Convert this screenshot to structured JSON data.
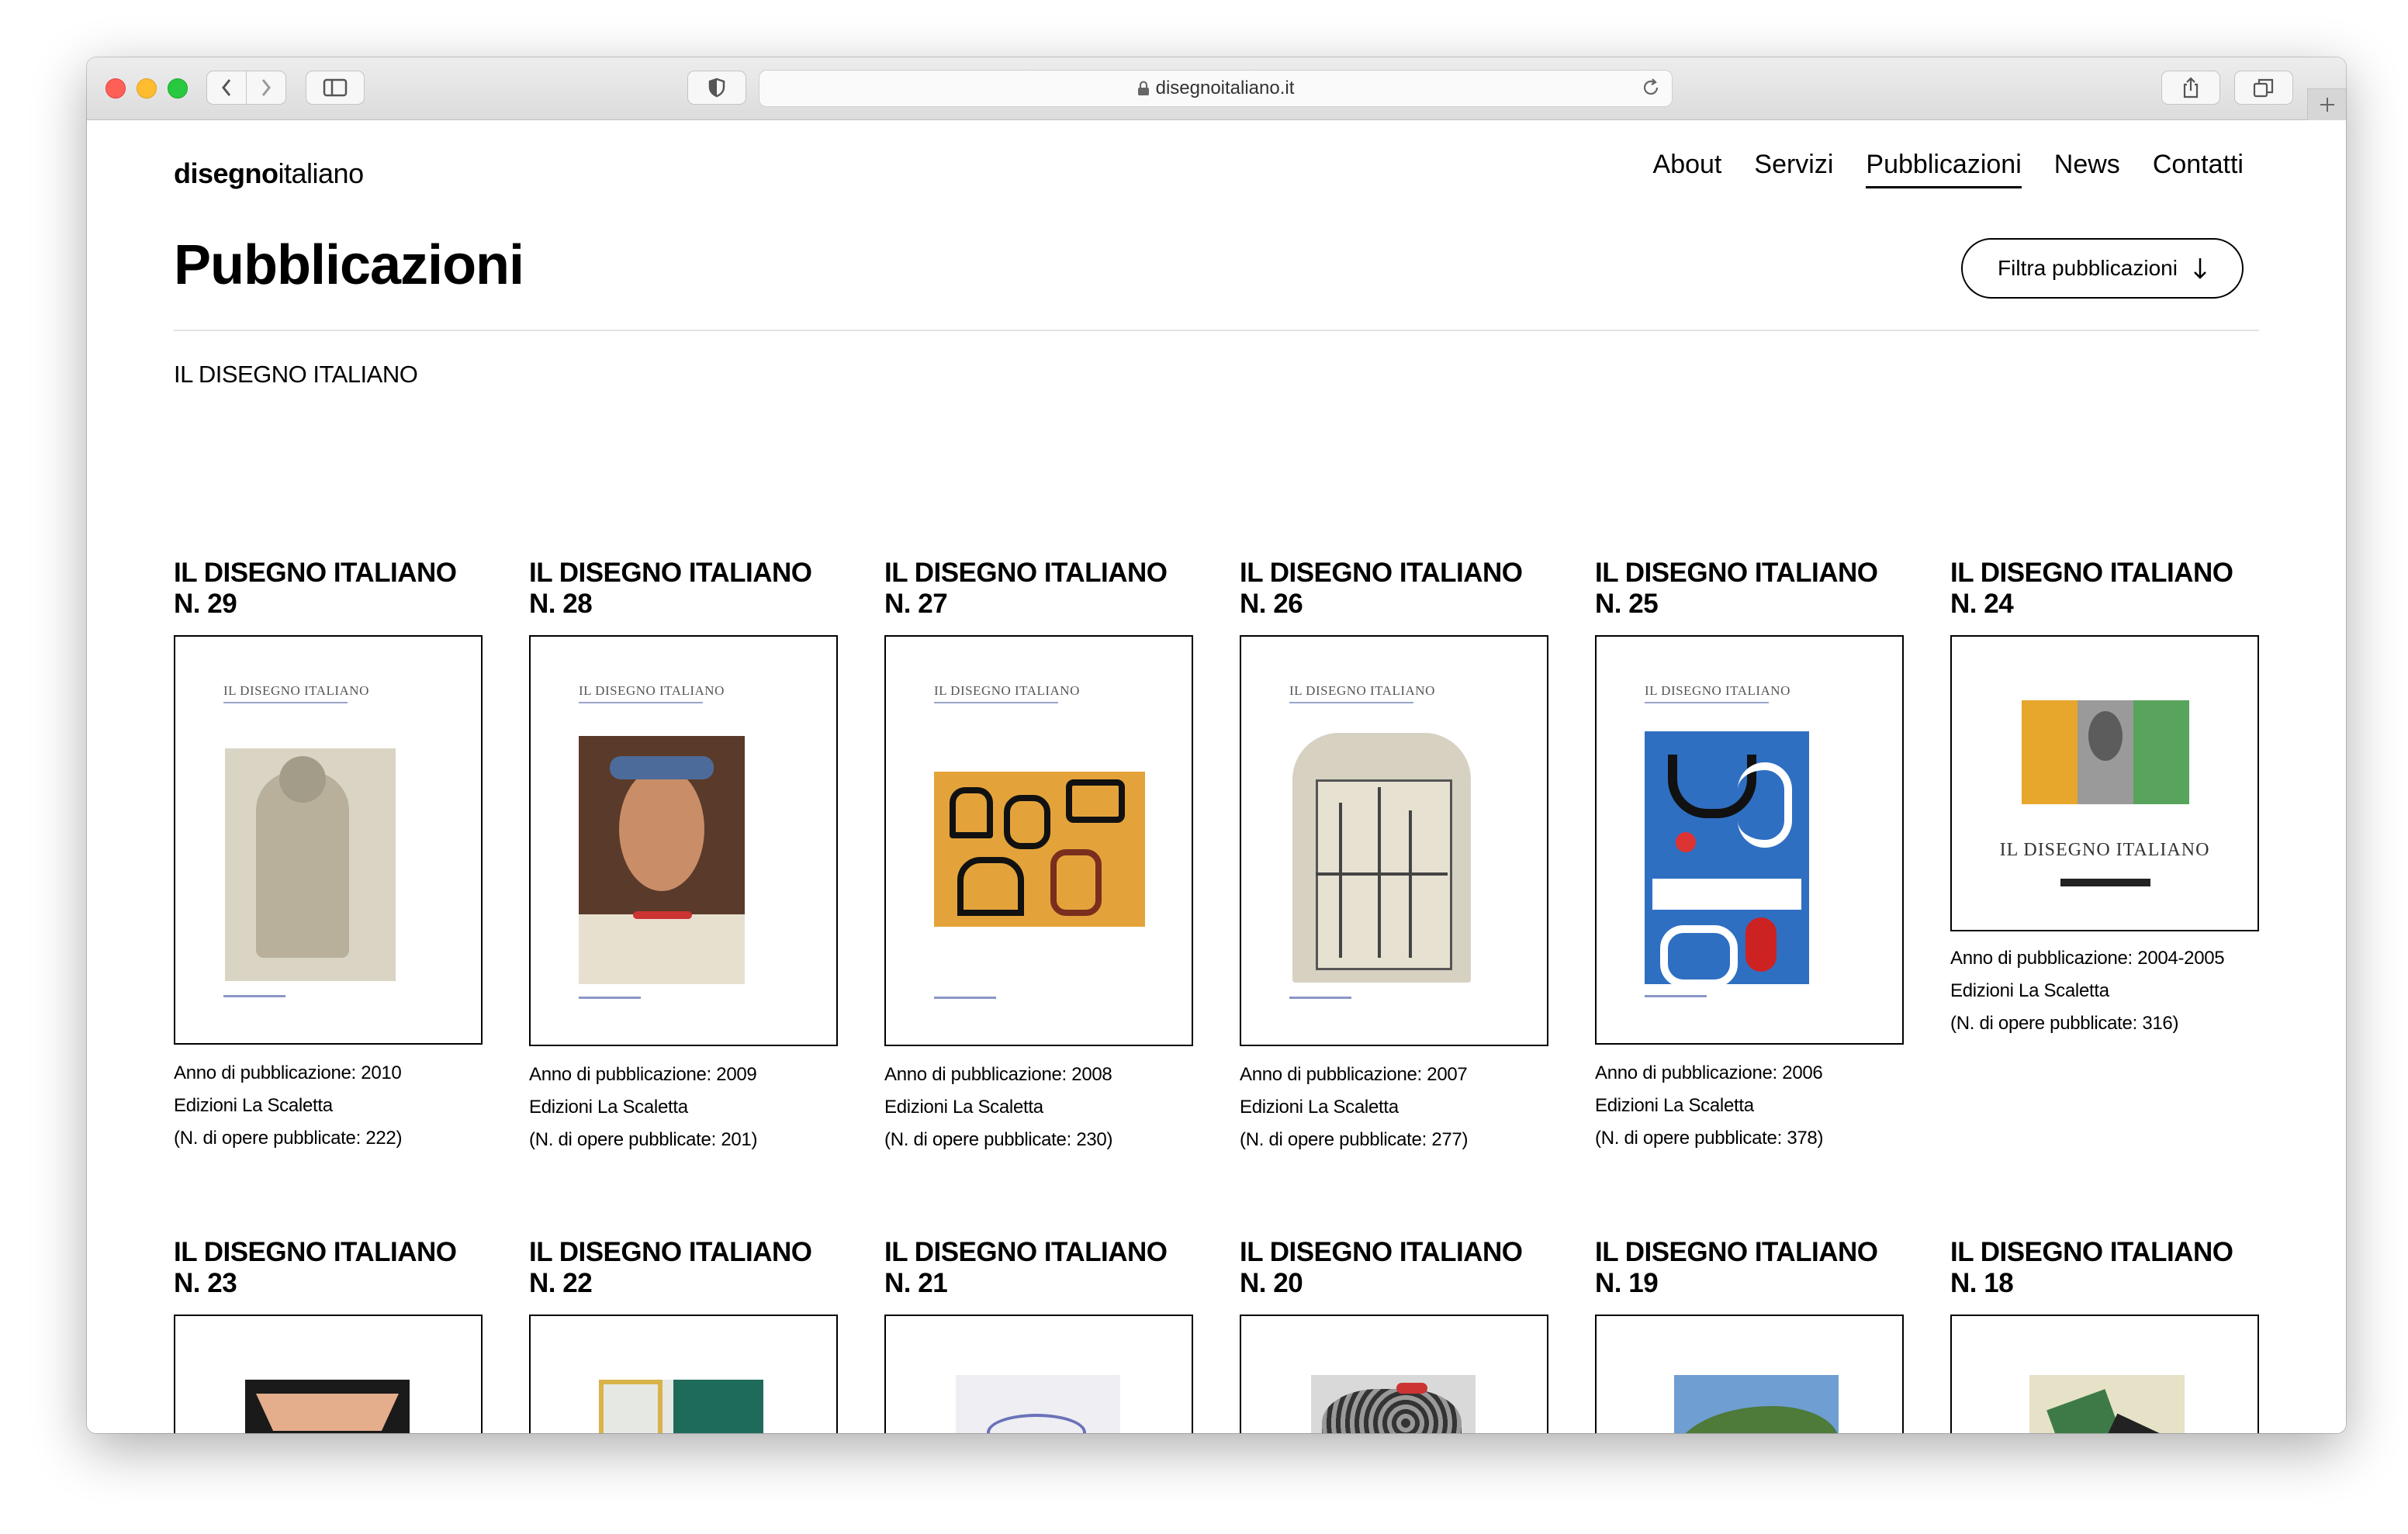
{
  "browser": {
    "url": "disegnoitaliano.it"
  },
  "site": {
    "logo_bold": "disegno",
    "logo_light": "italiano",
    "nav": [
      {
        "label": "About"
      },
      {
        "label": "Servizi"
      },
      {
        "label": "Pubblicazioni"
      },
      {
        "label": "News"
      },
      {
        "label": "Contatti"
      }
    ]
  },
  "page": {
    "title": "Pubblicazioni",
    "filter_label": "Filtra pubblicazioni",
    "section_label": "IL DISEGNO ITALIANO"
  },
  "publications": [
    {
      "title": "IL DISEGNO ITALIANO",
      "number": "N. 29",
      "year": "Anno di pubblicazione: 2010",
      "publisher": "Edizioni La Scaletta",
      "works": "(N. di opere pubblicate: 222)"
    },
    {
      "title": "IL DISEGNO ITALIANO",
      "number": "N. 28",
      "year": "Anno di pubblicazione: 2009",
      "publisher": "Edizioni La Scaletta",
      "works": "(N. di opere pubblicate: 201)"
    },
    {
      "title": "IL DISEGNO ITALIANO",
      "number": "N. 27",
      "year": "Anno di pubblicazione: 2008",
      "publisher": "Edizioni La Scaletta",
      "works": "(N. di opere pubblicate: 230)"
    },
    {
      "title": "IL DISEGNO ITALIANO",
      "number": "N. 26",
      "year": "Anno di pubblicazione: 2007",
      "publisher": "Edizioni La Scaletta",
      "works": "(N. di opere pubblicate: 277)"
    },
    {
      "title": "IL DISEGNO ITALIANO",
      "number": "N. 25",
      "year": "Anno di pubblicazione: 2006",
      "publisher": "Edizioni La Scaletta",
      "works": "(N. di opere pubblicate: 378)"
    },
    {
      "title": "IL DISEGNO ITALIANO",
      "number": "N. 24",
      "year": "Anno di pubblicazione: 2004-2005",
      "publisher": "Edizioni La Scaletta",
      "works": "(N. di opere pubblicate: 316)",
      "cover_text": "Il Disegno Italiano"
    },
    {
      "title": "IL DISEGNO ITALIANO",
      "number": "N. 23"
    },
    {
      "title": "IL DISEGNO ITALIANO",
      "number": "N. 22"
    },
    {
      "title": "IL DISEGNO ITALIANO",
      "number": "N. 21"
    },
    {
      "title": "IL DISEGNO ITALIANO",
      "number": "N. 20"
    },
    {
      "title": "IL DISEGNO ITALIANO",
      "number": "N. 19"
    },
    {
      "title": "IL DISEGNO ITALIANO",
      "number": "N. 18"
    }
  ],
  "icons": {
    "lock": "lock-icon",
    "reload": "reload-icon",
    "share": "share-icon",
    "tabs": "tabs-icon",
    "add_tab": "plus-icon",
    "sidebar": "sidebar-icon",
    "privacy": "shield-icon",
    "filter_arrow": "arrow-down-icon"
  }
}
